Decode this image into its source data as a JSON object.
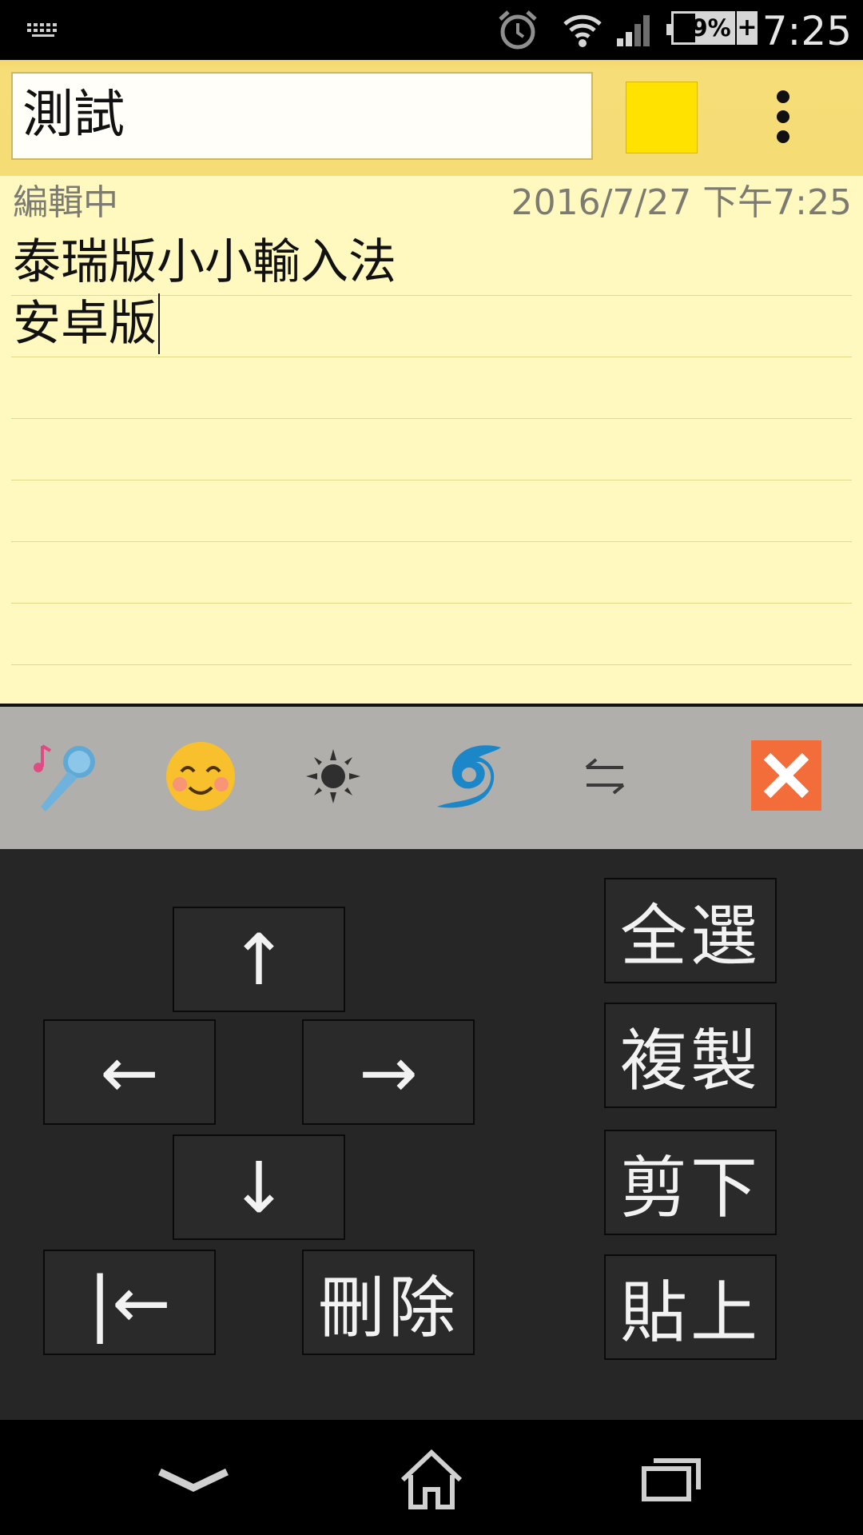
{
  "status_bar": {
    "time": "7:25",
    "battery": "59%",
    "icons": [
      "keyboard-icon",
      "alarm-icon",
      "wifi-icon",
      "signal-icon",
      "battery-icon"
    ]
  },
  "note": {
    "title": "測試",
    "color": "#ffe200",
    "status": "編輯中",
    "timestamp": "2016/7/27 下午7:25",
    "lines": [
      "泰瑞版小小輸入法",
      "安卓版"
    ]
  },
  "toolbar": {
    "icons": [
      "microphone-icon",
      "smiley-icon",
      "brightness-icon",
      "cyclone-icon",
      "swap-arrows-icon",
      "close-icon"
    ]
  },
  "keypad": {
    "up": "↑",
    "left": "←",
    "right": "→",
    "down": "↓",
    "home": "|←",
    "delete": "刪除",
    "select_all": "全選",
    "copy": "複製",
    "cut": "剪下",
    "paste": "貼上"
  },
  "nav": {
    "icons": [
      "back-chevron-icon",
      "home-icon",
      "recent-apps-icon"
    ]
  }
}
